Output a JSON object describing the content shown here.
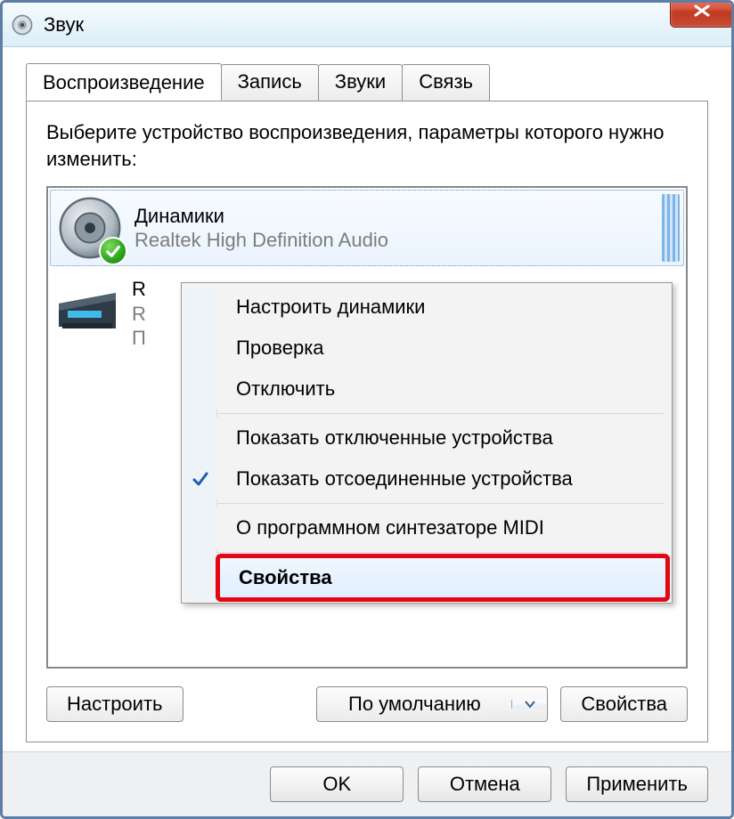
{
  "window": {
    "title": "Звук"
  },
  "tabs": [
    {
      "label": "Воспроизведение"
    },
    {
      "label": "Запись"
    },
    {
      "label": "Звуки"
    },
    {
      "label": "Связь"
    }
  ],
  "instruction": "Выберите устройство воспроизведения, параметры которого нужно изменить:",
  "devices": [
    {
      "name": "Динамики",
      "subtitle": "Realtek High Definition Audio",
      "initial": ""
    },
    {
      "name": "R",
      "subtitle": "R",
      "line3": "П"
    }
  ],
  "panel_buttons": {
    "configure": "Настроить",
    "default": "По умолчанию",
    "properties": "Свойства"
  },
  "dialog_buttons": {
    "ok": "OK",
    "cancel": "Отмена",
    "apply": "Применить"
  },
  "context_menu": {
    "configure": "Настроить динамики",
    "test": "Проверка",
    "disable": "Отключить",
    "show_disabled": "Показать отключенные устройства",
    "show_disconnected": "Показать отсоединенные устройства",
    "about_midi": "О программном синтезаторе MIDI",
    "properties": "Свойства"
  }
}
